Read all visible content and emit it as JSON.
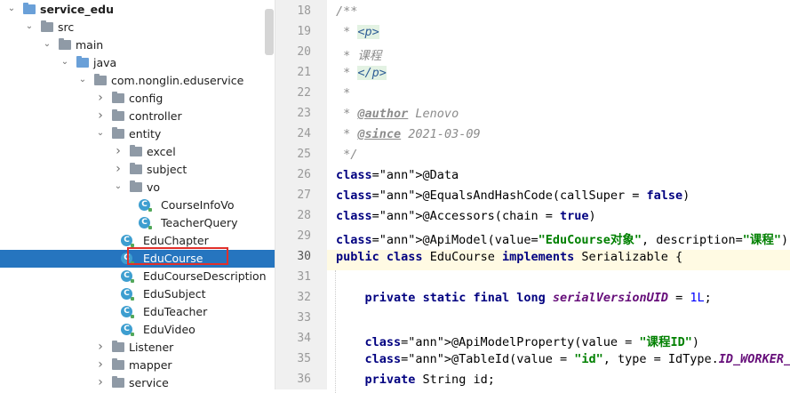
{
  "tree": {
    "items": [
      {
        "label": "service_edu",
        "type": "module"
      },
      {
        "label": "src",
        "type": "folder"
      },
      {
        "label": "main",
        "type": "folder"
      },
      {
        "label": "java",
        "type": "folder"
      },
      {
        "label": "com.nonglin.eduservice",
        "type": "package"
      },
      {
        "label": "config",
        "type": "package"
      },
      {
        "label": "controller",
        "type": "package"
      },
      {
        "label": "entity",
        "type": "package"
      },
      {
        "label": "excel",
        "type": "package"
      },
      {
        "label": "subject",
        "type": "package"
      },
      {
        "label": "vo",
        "type": "package"
      },
      {
        "label": "CourseInfoVo",
        "type": "class"
      },
      {
        "label": "TeacherQuery",
        "type": "class"
      },
      {
        "label": "EduChapter",
        "type": "class"
      },
      {
        "label": "EduCourse",
        "type": "class",
        "selected": true
      },
      {
        "label": "EduCourseDescription",
        "type": "class"
      },
      {
        "label": "EduSubject",
        "type": "class"
      },
      {
        "label": "EduTeacher",
        "type": "class"
      },
      {
        "label": "EduVideo",
        "type": "class"
      },
      {
        "label": "Listener",
        "type": "package"
      },
      {
        "label": "mapper",
        "type": "package"
      },
      {
        "label": "service",
        "type": "package"
      }
    ],
    "class_icon_letter": "C"
  },
  "editor": {
    "line_numbers": [
      "18",
      "19",
      "20",
      "21",
      "22",
      "23",
      "24",
      "25",
      "26",
      "27",
      "28",
      "29",
      "30",
      "31",
      "32",
      "33",
      "34",
      "35",
      "36"
    ],
    "current_line": "30",
    "lines": [
      "/**",
      " * <p>",
      " * 课程",
      " * </p>",
      " *",
      " * @author Lenovo",
      " * @since 2021-03-09",
      " */",
      "@Data",
      "@EqualsAndHashCode(callSuper = false)",
      "@Accessors(chain = true)",
      "@ApiModel(value=\"EduCourse对象\", description=\"课程\")",
      "public class EduCourse implements Serializable {",
      "",
      "    private static final long serialVersionUID = 1L;",
      "",
      "    @ApiModelProperty(value = \"课程ID\")",
      "    @TableId(value = \"id\", type = IdType.ID_WORKER_STR)",
      "    private String id;"
    ]
  },
  "colors": {
    "selection": "#2675bf",
    "highlight_box": "#e0302b",
    "keyword": "#000080",
    "string": "#008000",
    "annotation": "#808000",
    "comment": "#8c8c8c"
  }
}
